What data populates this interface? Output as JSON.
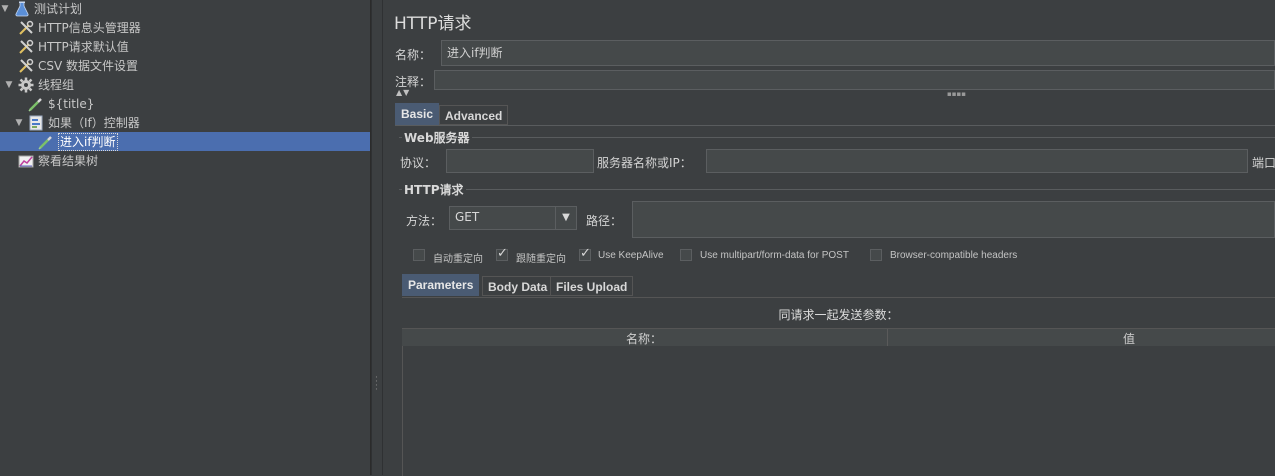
{
  "tree": {
    "items": [
      {
        "label": "测试计划",
        "toggle": "▼",
        "icon": "flask-icon"
      },
      {
        "label": "HTTP信息头管理器",
        "toggle": "",
        "icon": "wrench-icon"
      },
      {
        "label": "HTTP请求默认值",
        "toggle": "",
        "icon": "wrench-icon"
      },
      {
        "label": "CSV 数据文件设置",
        "toggle": "",
        "icon": "wrench-icon"
      },
      {
        "label": "线程组",
        "toggle": "▼",
        "icon": "gear-icon"
      },
      {
        "label": "${title}",
        "toggle": "",
        "icon": "pipette-icon"
      },
      {
        "label": "如果（If）控制器",
        "toggle": "▼",
        "icon": "controller-icon"
      },
      {
        "label": "进入if判断",
        "toggle": "",
        "icon": "pipette-icon"
      },
      {
        "label": "察看结果树",
        "toggle": "",
        "icon": "chart-icon"
      }
    ]
  },
  "panel": {
    "title": "HTTP请求",
    "name_label": "名称：",
    "name_value": "进入if判断",
    "comment_label": "注释："
  },
  "tabs": {
    "basic": "Basic",
    "advanced": "Advanced"
  },
  "web_server": {
    "title": "Web服务器",
    "protocol_label": "协议：",
    "server_label": "服务器名称或IP：",
    "port_label": "端口"
  },
  "http_request": {
    "title": "HTTP请求",
    "method_label": "方法：",
    "method_value": "GET",
    "path_label": "路径："
  },
  "options": [
    {
      "label": "自动重定向",
      "checked": false
    },
    {
      "label": "跟随重定向",
      "checked": true
    },
    {
      "label": "Use KeepAlive",
      "checked": true
    },
    {
      "label": "Use multipart/form-data for POST",
      "checked": false
    },
    {
      "label": "Browser-compatible headers",
      "checked": false
    }
  ],
  "subtabs": {
    "parameters": "Parameters",
    "body_data": "Body Data",
    "files_upload": "Files Upload"
  },
  "params": {
    "caption": "同请求一起发送参数：",
    "col_name": "名称：",
    "col_value": "值"
  },
  "colors": {
    "background": "#3c3f41",
    "selection": "#4b6eaf",
    "active_tab": "#4a5b73"
  }
}
